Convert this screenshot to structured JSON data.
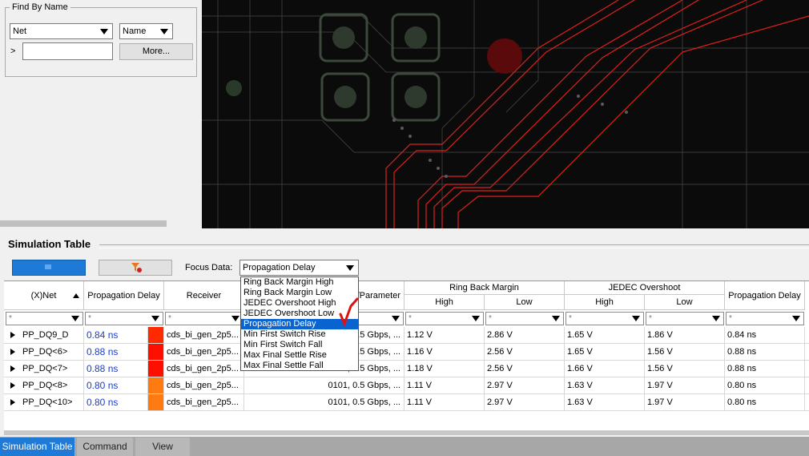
{
  "find_panel": {
    "title": "Find By Name",
    "type_select": "Net",
    "name_select": "Name",
    "prompt": ">",
    "input_value": "",
    "more_button": "More..."
  },
  "sim_table": {
    "title": "Simulation Table",
    "focus_label": "Focus Data:",
    "focus_value": "Propagation Delay",
    "dropdown_options": [
      "Ring Back Margin High",
      "Ring Back Margin Low",
      "JEDEC Overshoot High",
      "JEDEC Overshoot Low",
      "Propagation Delay",
      "Min First Switch Rise",
      "Min First Switch Fall",
      "Max Final Settle Rise",
      "Max Final Settle Fall"
    ],
    "selected_option": "Propagation Delay",
    "columns": {
      "net": "(X)Net",
      "prop_delay": "Propagation Delay",
      "receiver": "Receiver",
      "parameter": "/Parameter",
      "ring_back": "Ring Back Margin",
      "jedec": "JEDEC Overshoot",
      "high": "High",
      "low": "Low",
      "prop_delay2": "Propagation Delay"
    },
    "filter_placeholder": "*",
    "rows": [
      {
        "net": "PP_DQ9_D",
        "delay": "0.84 ns",
        "color": "#ff2a00",
        "receiver": "cds_bi_gen_2p5...",
        "param": ".5 Gbps, ...",
        "rb_high": "1.12 V",
        "rb_low": "2.86 V",
        "j_high": "1.65 V",
        "j_low": "1.86 V",
        "delay2": "0.84 ns"
      },
      {
        "net": "PP_DQ<6>",
        "delay": "0.88 ns",
        "color": "#ff0f00",
        "receiver": "cds_bi_gen_2p5...",
        "param": ".5 Gbps, ...",
        "rb_high": "1.16 V",
        "rb_low": "2.56 V",
        "j_high": "1.65 V",
        "j_low": "1.56 V",
        "delay2": "0.88 ns"
      },
      {
        "net": "PP_DQ<7>",
        "delay": "0.88 ns",
        "color": "#ff0f00",
        "receiver": "cds_bi_gen_2p5...",
        "param": "0101, 0.5 Gbps, ...",
        "rb_high": "1.18 V",
        "rb_low": "2.56 V",
        "j_high": "1.66 V",
        "j_low": "1.56 V",
        "delay2": "0.88 ns"
      },
      {
        "net": "PP_DQ<8>",
        "delay": "0.80 ns",
        "color": "#ff7a10",
        "receiver": "cds_bi_gen_2p5...",
        "param": "0101, 0.5 Gbps, ...",
        "rb_high": "1.11 V",
        "rb_low": "2.97 V",
        "j_high": "1.63 V",
        "j_low": "1.97 V",
        "delay2": "0.80 ns"
      },
      {
        "net": "PP_DQ<10>",
        "delay": "0.80 ns",
        "color": "#ff7a10",
        "receiver": "cds_bi_gen_2p5...",
        "param": "0101, 0.5 Gbps, ...",
        "rb_high": "1.11 V",
        "rb_low": "2.97 V",
        "j_high": "1.63 V",
        "j_low": "1.97 V",
        "delay2": "0.80 ns"
      }
    ]
  },
  "tabs": [
    "Simulation Table",
    "Command",
    "View"
  ],
  "colors": {
    "accent": "#1e7ad6",
    "selection": "#0a64d0"
  }
}
